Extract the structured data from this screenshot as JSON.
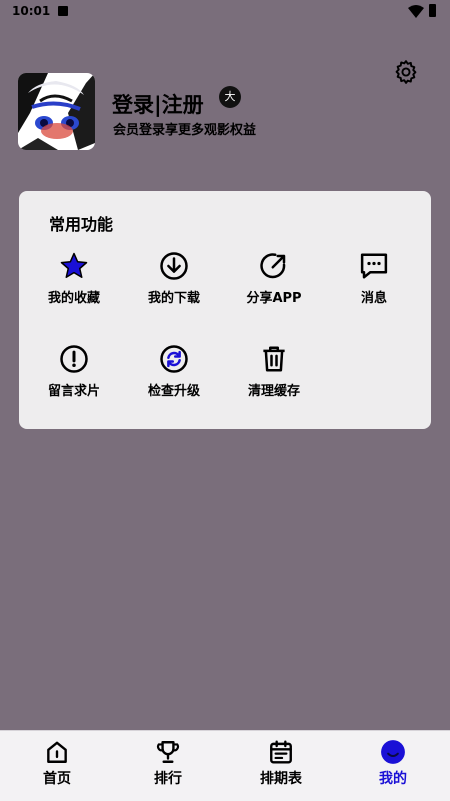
{
  "status_bar": {
    "time": "10:01"
  },
  "profile": {
    "login_label": "登录|注册",
    "vip_badge": "大",
    "subtitle": "会员登录享更多观影权益"
  },
  "common": {
    "title": "常用功能",
    "items": [
      {
        "label": "我的收藏",
        "icon": "star-icon"
      },
      {
        "label": "我的下载",
        "icon": "download-icon"
      },
      {
        "label": "分享APP",
        "icon": "share-icon"
      },
      {
        "label": "消息",
        "icon": "message-icon"
      },
      {
        "label": "留言求片",
        "icon": "alert-icon"
      },
      {
        "label": "检查升级",
        "icon": "refresh-icon"
      },
      {
        "label": "清理缓存",
        "icon": "trash-icon"
      }
    ]
  },
  "tabs": [
    {
      "label": "首页",
      "icon": "home-icon"
    },
    {
      "label": "排行",
      "icon": "trophy-icon"
    },
    {
      "label": "排期表",
      "icon": "calendar-icon"
    },
    {
      "label": "我的",
      "icon": "user-icon",
      "active": true
    }
  ],
  "colors": {
    "background": "#7a6e7b",
    "accent": "#1a10d6",
    "card": "#eeedee"
  }
}
